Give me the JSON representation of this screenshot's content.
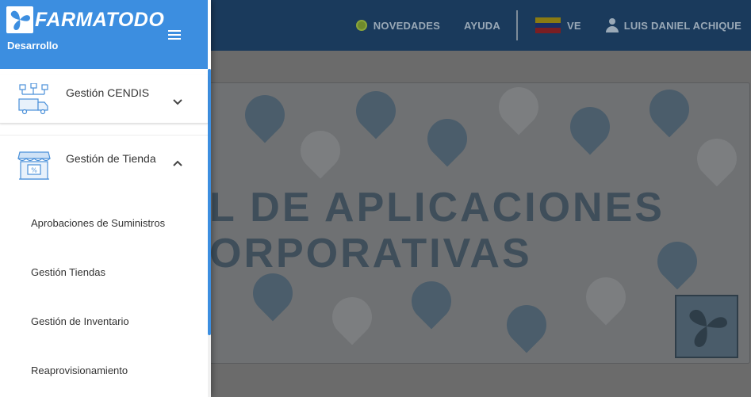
{
  "app": {
    "brand": "FARMATODO",
    "environment": "Desarrollo"
  },
  "topbar": {
    "novedades": "NOVEDADES",
    "ayuda": "AYUDA",
    "country": "VE",
    "user": "LUIS DANIEL ACHIQUE"
  },
  "banner": {
    "line1": "L DE APLICACIONES",
    "line2": "ORPORATIVAS"
  },
  "sidebar": {
    "groups": [
      {
        "label": "Gestión CENDIS",
        "icon": "distribution-center-icon",
        "expanded": false
      },
      {
        "label": "Gestión de Tienda",
        "icon": "store-icon",
        "expanded": true
      }
    ],
    "store_items": [
      {
        "label": "Aprobaciones de Suministros"
      },
      {
        "label": "Gestión Tiendas"
      },
      {
        "label": "Gestión de Inventario"
      },
      {
        "label": "Reaprovisionamiento"
      }
    ]
  },
  "colors": {
    "header_blue": "#3c8ee0",
    "topbar_dimmed": "#1a3a5c",
    "icon_blue": "#4a90d9"
  }
}
